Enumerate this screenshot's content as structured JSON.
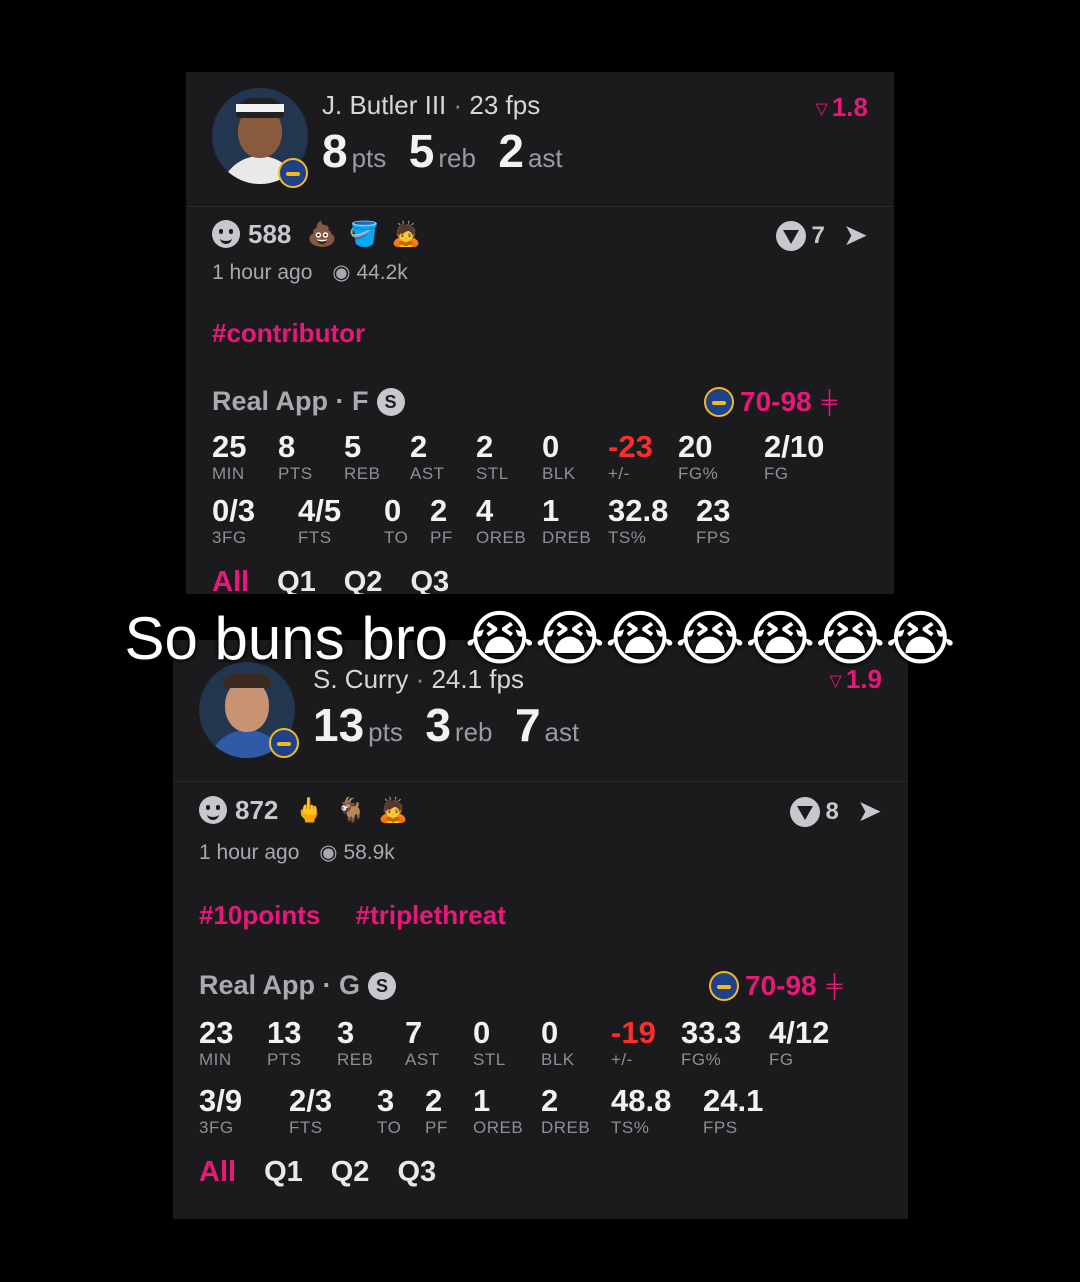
{
  "caption": {
    "text": "So buns bro",
    "emojis": "😭😭😭😭😭😭😭"
  },
  "cards": [
    {
      "player": {
        "name": "J. Butler III",
        "fps": "23 fps",
        "pts": "8",
        "reb": "5",
        "ast": "2",
        "delta": "1.8",
        "pts_unit": "pts",
        "reb_unit": "reb",
        "ast_unit": "ast"
      },
      "reactions": {
        "count": "588",
        "emojis": [
          "💩",
          "🪣",
          "🙇"
        ],
        "votes": "7"
      },
      "time": "1 hour ago",
      "views": "44.2k",
      "tags": [
        "#contributor"
      ],
      "app": {
        "label": "Real App · F",
        "badge": "S",
        "score": "70-98"
      },
      "row1": [
        {
          "v": "25",
          "l": "MIN"
        },
        {
          "v": "8",
          "l": "PTS"
        },
        {
          "v": "5",
          "l": "REB"
        },
        {
          "v": "2",
          "l": "AST"
        },
        {
          "v": "2",
          "l": "STL"
        },
        {
          "v": "0",
          "l": "BLK"
        },
        {
          "v": "-23",
          "l": "+/-"
        },
        {
          "v": "20",
          "l": "FG%"
        },
        {
          "v": "2/10",
          "l": "FG"
        }
      ],
      "row2": [
        {
          "v": "0/3",
          "l": "3FG"
        },
        {
          "v": "4/5",
          "l": "FTS"
        },
        {
          "v": "0",
          "l": "TO"
        },
        {
          "v": "2",
          "l": "PF"
        },
        {
          "v": "4",
          "l": "OREB"
        },
        {
          "v": "1",
          "l": "DREB"
        },
        {
          "v": "32.8",
          "l": "TS%"
        },
        {
          "v": "23",
          "l": "FPS"
        }
      ],
      "quarters": [
        "All",
        "Q1",
        "Q2",
        "Q3"
      ]
    },
    {
      "player": {
        "name": "S. Curry",
        "fps": "24.1 fps",
        "pts": "13",
        "reb": "3",
        "ast": "7",
        "delta": "1.9",
        "pts_unit": "pts",
        "reb_unit": "reb",
        "ast_unit": "ast"
      },
      "reactions": {
        "count": "872",
        "emojis": [
          "🖕",
          "🐐",
          "🙇"
        ],
        "votes": "8"
      },
      "time": "1 hour ago",
      "views": "58.9k",
      "tags": [
        "#10points",
        "#triplethreat"
      ],
      "app": {
        "label": "Real App · G",
        "badge": "S",
        "score": "70-98"
      },
      "row1": [
        {
          "v": "23",
          "l": "MIN"
        },
        {
          "v": "13",
          "l": "PTS"
        },
        {
          "v": "3",
          "l": "REB"
        },
        {
          "v": "7",
          "l": "AST"
        },
        {
          "v": "0",
          "l": "STL"
        },
        {
          "v": "0",
          "l": "BLK"
        },
        {
          "v": "-19",
          "l": "+/-"
        },
        {
          "v": "33.3",
          "l": "FG%"
        },
        {
          "v": "4/12",
          "l": "FG"
        }
      ],
      "row2": [
        {
          "v": "3/9",
          "l": "3FG"
        },
        {
          "v": "2/3",
          "l": "FTS"
        },
        {
          "v": "3",
          "l": "TO"
        },
        {
          "v": "2",
          "l": "PF"
        },
        {
          "v": "1",
          "l": "OREB"
        },
        {
          "v": "2",
          "l": "DREB"
        },
        {
          "v": "48.8",
          "l": "TS%"
        },
        {
          "v": "24.1",
          "l": "FPS"
        }
      ],
      "quarters": [
        "All",
        "Q1",
        "Q2",
        "Q3"
      ]
    }
  ],
  "colors": {
    "accent": "#e8187a",
    "negative": "#ff2d2d",
    "card_bg": "#1b1b1d",
    "page_bg": "#000000"
  }
}
